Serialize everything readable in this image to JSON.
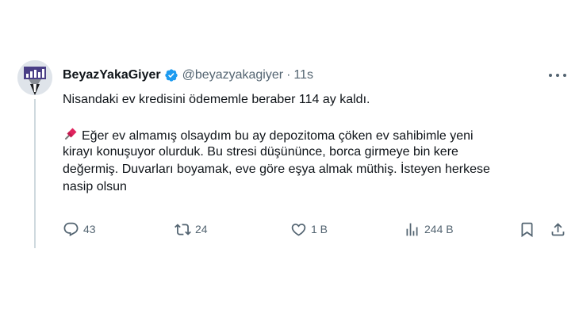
{
  "tweet": {
    "display_name": "BeyazYakaGiyer",
    "handle": "@beyazyakagiyer",
    "separator": "·",
    "time": "11s",
    "line1": "Nisandaki ev kredisini ödememle beraber 114 ay kaldı.",
    "para2": [
      "Eğer ev almamış olsaydım bu ay depozitoma çöken ev sahibimle yeni",
      "kirayı konuşuyor olurduk. Bu stresi düşününce, borca girmeye bin kere",
      "değermiş. Duvarları boyamak, eve göre eşya almak müthiş. İsteyen herkese",
      "nasip olsun"
    ]
  },
  "actions": {
    "replies": "43",
    "retweets": "24",
    "likes": "1 B",
    "views": "244 B"
  },
  "icons": {
    "verified": "verified-badge-icon",
    "pin": "pushpin-icon",
    "reply": "reply-icon",
    "retweet": "retweet-icon",
    "like": "heart-icon",
    "views": "views-icon",
    "bookmark": "bookmark-icon",
    "share": "share-icon",
    "more": "more-icon"
  },
  "colors": {
    "verified": "#1d9bf0",
    "text": "#0f1419",
    "secondary": "#536471",
    "pin": "#e0245e"
  }
}
